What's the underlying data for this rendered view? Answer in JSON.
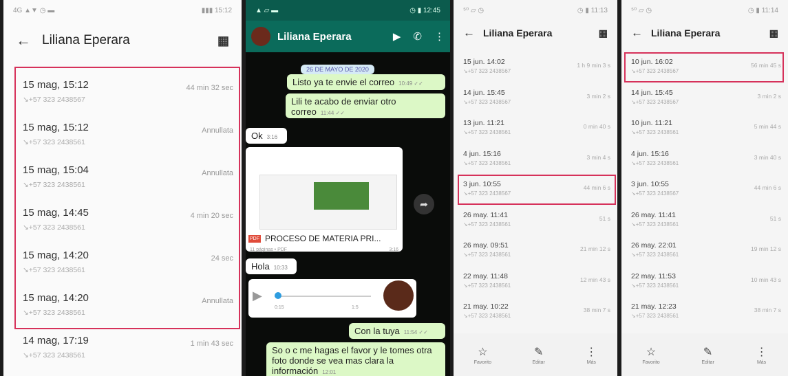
{
  "panel1": {
    "status_left": "4G ▲▼ ◷ ▬",
    "status_right": "▮▮▮ 15:12",
    "title": "Liliana Eperara",
    "calls": [
      {
        "date": "15 mag, 15:12",
        "number": "↘+57 323 2438567",
        "duration": "44 min 32 sec"
      },
      {
        "date": "15 mag, 15:12",
        "number": "↘+57 323 2438561",
        "duration": "Annullata"
      },
      {
        "date": "15 mag, 15:04",
        "number": "↘+57 323 2438561",
        "duration": "Annullata"
      },
      {
        "date": "15 mag, 14:45",
        "number": "↘+57 323 2438561",
        "duration": "4 min 20 sec"
      },
      {
        "date": "15 mag, 14:20",
        "number": "↘+57 323 2438561",
        "duration": "24 sec"
      },
      {
        "date": "15 mag, 14:20",
        "number": "↘+57 323 2438561",
        "duration": "Annullata"
      },
      {
        "date": "14 mag, 17:19",
        "number": "↘+57 323 2438561",
        "duration": "1 min 43 sec"
      }
    ]
  },
  "panel2": {
    "status_left": "▲ ▱ ▬",
    "status_right": "◷ ▮ 12:45",
    "title": "Liliana Eperara",
    "date_pill": "26 DE MAYO DE 2020",
    "messages": [
      {
        "text": "Listo ya te envie el correo",
        "time": "10:49 ✓✓"
      },
      {
        "text": "Lili te acabo de enviar otro correo",
        "time": "11:44 ✓✓"
      },
      {
        "text": "Ok",
        "time": "3:16"
      },
      {
        "text": "PROCESO DE MATERIA PRI...",
        "time": "3:16"
      },
      {
        "text": "Hola",
        "time": "10:33"
      },
      {
        "text": "Con la tuya",
        "time": "11:54 ✓✓"
      },
      {
        "text": "So o c me hagas el favor y le tomes otra foto donde se vea mas clara la información",
        "time": "12:01"
      }
    ],
    "doc_meta": "11 páginas • PDF",
    "audio_start": "0:15",
    "audio_end": "1:5"
  },
  "panel3": {
    "status_left": "⁵⁰ ▱ ◷",
    "status_right": "◷ ▮ 11:13",
    "title": "Liliana Eperara",
    "calls": [
      {
        "date": "15 jun. 14:02",
        "number": "↘+57 323 2438567",
        "duration": "1 h 9 min 3 s"
      },
      {
        "date": "14 jun. 15:45",
        "number": "↘+57 323 2438567",
        "duration": "3 min 2 s"
      },
      {
        "date": "13 jun. 11:21",
        "number": "↘+57 323 2438561",
        "duration": "0 min 40 s"
      },
      {
        "date": "4 jun. 15:16",
        "number": "↘+57 323 2438561",
        "duration": "3 min 4 s"
      },
      {
        "date": "3 jun. 10:55",
        "number": "↘+57 323 2438567",
        "duration": "44 min 6 s"
      },
      {
        "date": "26 may. 11:41",
        "number": "↘+57 323 2438561",
        "duration": "51 s"
      },
      {
        "date": "26 may. 09:51",
        "number": "↘+57 323 2438561",
        "duration": "21 min 12 s"
      },
      {
        "date": "22 may. 11:48",
        "number": "↘+57 323 2438561",
        "duration": "12 min 43 s"
      },
      {
        "date": "21 may. 10:22",
        "number": "↘+57 323 2438561",
        "duration": "38 min 7 s"
      }
    ],
    "bottom": [
      {
        "icon": "☆",
        "label": "Favorito"
      },
      {
        "icon": "✎",
        "label": "Editar"
      },
      {
        "icon": "⋮",
        "label": "Más"
      }
    ]
  },
  "panel4": {
    "status_left": "⁵⁰ ▱ ◷",
    "status_right": "◷ ▮ 11:14",
    "title": "Liliana Eperara",
    "calls": [
      {
        "date": "10 jun. 16:02",
        "number": "↘+57 323 2438567",
        "duration": "56 min 45 s"
      },
      {
        "date": "14 jun. 15:45",
        "number": "↘+57 323 2438567",
        "duration": "3 min 2 s"
      },
      {
        "date": "10 jun. 11:21",
        "number": "↘+57 323 2438561",
        "duration": "5 min 44 s"
      },
      {
        "date": "4 jun. 15:16",
        "number": "↘+57 323 2438561",
        "duration": "3 min 40 s"
      },
      {
        "date": "3 jun. 10:55",
        "number": "↘+57 323 2438567",
        "duration": "44 min 6 s"
      },
      {
        "date": "26 may. 11:41",
        "number": "↘+57 323 2438561",
        "duration": "51 s"
      },
      {
        "date": "26 may. 22:01",
        "number": "↘+57 323 2438561",
        "duration": "19 min 12 s"
      },
      {
        "date": "22 may. 11:53",
        "number": "↘+57 323 2438561",
        "duration": "10 min 43 s"
      },
      {
        "date": "21 may. 12:23",
        "number": "↘+57 323 2438561",
        "duration": "38 min 7 s"
      }
    ],
    "bottom": [
      {
        "icon": "☆",
        "label": "Favorito"
      },
      {
        "icon": "✎",
        "label": "Editar"
      },
      {
        "icon": "⋮",
        "label": "Más"
      }
    ]
  }
}
